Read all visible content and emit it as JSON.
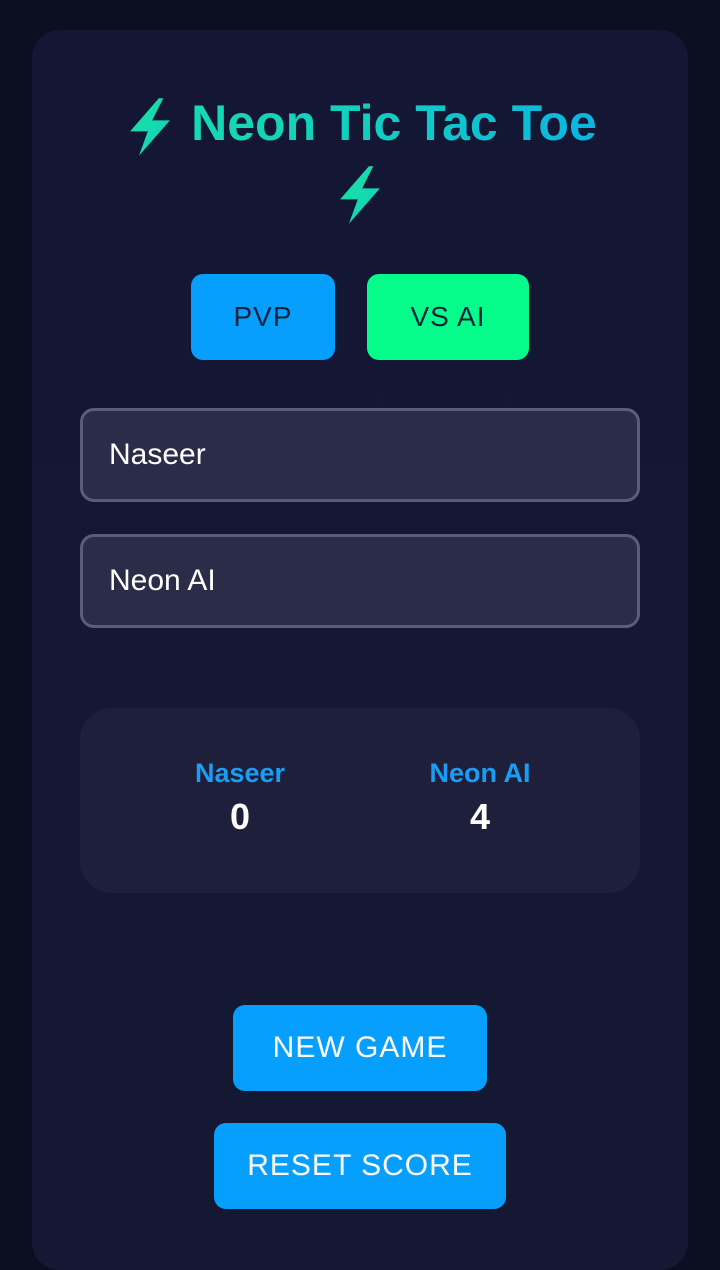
{
  "header": {
    "title_text": "Neon Tic Tac Toe",
    "icon": "lightning-bolt-icon"
  },
  "modes": {
    "pvp_label": "PVP",
    "vs_ai_label": "VS AI"
  },
  "players": {
    "player1_name": "Naseer",
    "player2_name": "Neon AI"
  },
  "scoreboard": {
    "player1": {
      "name": "Naseer",
      "score": "0"
    },
    "player2": {
      "name": "Neon AI",
      "score": "4"
    }
  },
  "actions": {
    "new_game_label": "NEW GAME",
    "reset_score_label": "RESET SCORE"
  },
  "colors": {
    "accent_blue": "#079ffd",
    "accent_green": "#05fc8b",
    "title_gradient_start": "#1be3a0",
    "title_gradient_end": "#0aa6f0",
    "background": "#131733"
  }
}
